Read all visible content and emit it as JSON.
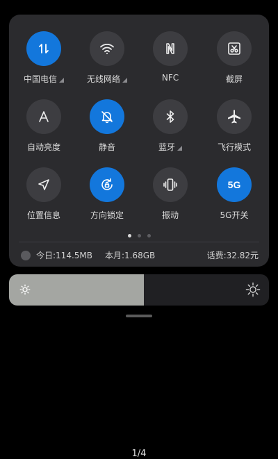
{
  "tiles": [
    {
      "label": "中国电信",
      "icon": "data-transfer-icon",
      "active": true,
      "has_arrow": true
    },
    {
      "label": "无线网络",
      "icon": "wifi-icon",
      "active": false,
      "has_arrow": true
    },
    {
      "label": "NFC",
      "icon": "nfc-icon",
      "active": false,
      "has_arrow": false
    },
    {
      "label": "截屏",
      "icon": "screenshot-icon",
      "active": false,
      "has_arrow": false
    },
    {
      "label": "自动亮度",
      "icon": "auto-brightness-icon",
      "active": false,
      "has_arrow": false
    },
    {
      "label": "静音",
      "icon": "mute-bell-icon",
      "active": true,
      "has_arrow": false
    },
    {
      "label": "蓝牙",
      "icon": "bluetooth-icon",
      "active": false,
      "has_arrow": true
    },
    {
      "label": "飞行模式",
      "icon": "airplane-icon",
      "active": false,
      "has_arrow": false
    },
    {
      "label": "位置信息",
      "icon": "location-icon",
      "active": false,
      "has_arrow": false
    },
    {
      "label": "方向锁定",
      "icon": "rotation-lock-icon",
      "active": true,
      "has_arrow": false
    },
    {
      "label": "振动",
      "icon": "vibrate-icon",
      "active": false,
      "has_arrow": false
    },
    {
      "label": "5G开关",
      "icon": "5g-icon",
      "active": true,
      "has_arrow": false,
      "icon_text": "5G"
    }
  ],
  "pager": {
    "current_dot": 0,
    "dot_count": 3
  },
  "data_usage": {
    "today": "今日:114.5MB",
    "month": "本月:1.68GB",
    "fee": "话费:32.82元"
  },
  "brightness": {
    "level": 0.52
  },
  "page_indicator": "1/4",
  "colors": {
    "accent": "#1377dc",
    "panel": "#2b2b2e",
    "tile_inactive": "#3d3d41",
    "brightness_fill": "#a4a6a2"
  }
}
